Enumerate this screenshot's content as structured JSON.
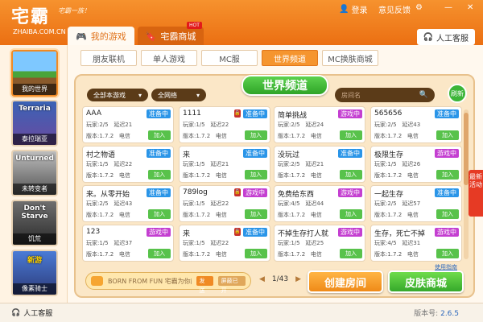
{
  "app": {
    "logo_text": "宅霸",
    "logo_sub": "ZHAIBA.COM.CN",
    "slogan": "宅霸一族！"
  },
  "titlebar": {
    "login_label": "登录",
    "feedback_label": "意见反馈",
    "colors": {
      "bg": "#ef7a1e",
      "accent": "#f5952f"
    }
  },
  "tabs": [
    {
      "label": "我的游戏",
      "icon": "gamepad-icon"
    },
    {
      "label": "宅霸商城",
      "icon": "bookmark-icon"
    }
  ],
  "hot_badge": "HOT",
  "support_label": "人工客服",
  "subtabs": [
    "朋友联机",
    "单人游戏",
    "MC服",
    "世界频道",
    "MC换肤商城"
  ],
  "left_games": [
    {
      "label": "我的世界",
      "title": ""
    },
    {
      "label": "泰拉瑞亚",
      "title": "Terraria"
    },
    {
      "label": "未转变者",
      "title": "Unturned"
    },
    {
      "label": "饥荒",
      "title": "Don't Starve"
    },
    {
      "label": "像素骑士",
      "title": "新游"
    }
  ],
  "panel": {
    "banner": "世界频道",
    "filter1": "全部本游戏",
    "filter2": "全网络",
    "search_placeholder": "房间名",
    "refresh_label": "刷新"
  },
  "status_labels": {
    "ready": "准备中",
    "playing": "游戏中"
  },
  "join_label": "加入",
  "rooms": [
    {
      "name": "AAA",
      "status": "准备中",
      "players": "玩家:2/5",
      "latency": "延迟21",
      "version": "版本:1.7.2",
      "mode": "电信",
      "lock": false
    },
    {
      "name": "1111",
      "status": "准备中",
      "players": "玩家:1/5",
      "latency": "延迟22",
      "version": "版本:1.7.2",
      "mode": "电信",
      "lock": true
    },
    {
      "name": "简单挑战",
      "status": "游戏中",
      "players": "玩家:2/5",
      "latency": "延迟24",
      "version": "版本:1.7.2",
      "mode": "电信",
      "lock": false
    },
    {
      "name": "565656",
      "status": "准备中",
      "players": "玩家:2/5",
      "latency": "延迟43",
      "version": "版本:1.7.2",
      "mode": "电信",
      "lock": false
    },
    {
      "name": "村之物语",
      "status": "准备中",
      "players": "玩家:1/5",
      "latency": "延迟22",
      "version": "版本:1.7.2",
      "mode": "电信",
      "lock": false
    },
    {
      "name": "来",
      "status": "准备中",
      "players": "玩家:1/5",
      "latency": "延迟21",
      "version": "版本:1.7.2",
      "mode": "电信",
      "lock": false
    },
    {
      "name": "没玩过",
      "status": "准备中",
      "players": "玩家:2/5",
      "latency": "延迟21",
      "version": "版本:1.7.2",
      "mode": "电信",
      "lock": false
    },
    {
      "name": "极限生存",
      "status": "游戏中",
      "players": "玩家:1/5",
      "latency": "延迟26",
      "version": "版本:1.7.2",
      "mode": "电信",
      "lock": false
    },
    {
      "name": "来。从零开始",
      "status": "准备中",
      "players": "玩家:2/5",
      "latency": "延迟43",
      "version": "版本:1.7.2",
      "mode": "电信",
      "lock": false
    },
    {
      "name": "789log",
      "status": "游戏中",
      "players": "玩家:1/5",
      "latency": "延迟22",
      "version": "版本:1.7.2",
      "mode": "电信",
      "lock": true
    },
    {
      "name": "免费给东西",
      "status": "游戏中",
      "players": "玩家:4/5",
      "latency": "延迟44",
      "version": "版本:1.7.2",
      "mode": "电信",
      "lock": false
    },
    {
      "name": "一起生存",
      "status": "准备中",
      "players": "玩家:2/5",
      "latency": "延迟57",
      "version": "版本:1.7.2",
      "mode": "电信",
      "lock": false
    },
    {
      "name": "123",
      "status": "游戏中",
      "players": "玩家:1/5",
      "latency": "延迟37",
      "version": "版本:1.7.2",
      "mode": "电信",
      "lock": false
    },
    {
      "name": "来",
      "status": "准备中",
      "players": "玩家:1/5",
      "latency": "延迟22",
      "version": "版本:1.7.2",
      "mode": "电信",
      "lock": true
    },
    {
      "name": "不掉生存打人就",
      "status": "游戏中",
      "players": "玩家:1/5",
      "latency": "延迟25",
      "version": "版本:1.7.2",
      "mode": "电信",
      "lock": false
    },
    {
      "name": "生存，死亡不掉",
      "status": "游戏中",
      "players": "玩家:4/5",
      "latency": "延迟31",
      "version": "版本:1.7.2",
      "mode": "电信",
      "lock": false
    }
  ],
  "help_link": "使用指南",
  "chat": {
    "message": "BORN FROM FUN 宅霸为你献上",
    "send_label": "发送",
    "mute_label": "屏蔽已开"
  },
  "pager": {
    "prev": "◀",
    "text": "1/43",
    "next": "▶"
  },
  "buttons": {
    "create_room": "创建房间",
    "skin_shop": "皮肤商城"
  },
  "activity_tab": "最新活动",
  "statusbar": {
    "support_label": "人工客服",
    "version_label": "版本号:",
    "version": "2.6.5"
  }
}
